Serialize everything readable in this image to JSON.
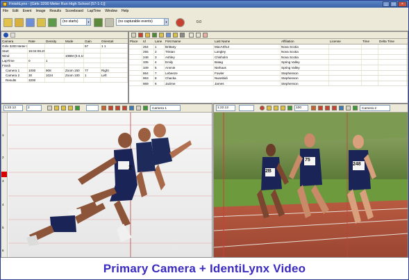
{
  "window": {
    "title": "FinishLynx - [Girls 3200 Meter Run High School (57-1-1)]",
    "buttons": [
      "_",
      "□",
      "×"
    ]
  },
  "menubar": [
    "File",
    "Edit",
    "Event",
    "Image",
    "Results",
    "Scoreboard",
    "LapTime",
    "Window",
    "Help"
  ],
  "toolbar": {
    "starts_select": "(no starts)",
    "events_select": "(no capturable events)",
    "counter": "0.0"
  },
  "event_panel": {
    "columns": [
      "Camera",
      "Rate",
      "Density",
      "Mode",
      "Gain",
      "Orientati"
    ],
    "rows": [
      {
        "cells": [
          "Girls 3200 Meter Run High School",
          "",
          "",
          "",
          "57",
          "1   1"
        ],
        "sub": false
      },
      {
        "cells": [
          "Start",
          "15:04:08.25",
          "",
          "",
          "",
          ""
        ],
        "sub": false
      },
      {
        "cells": [
          "Wind",
          "",
          "",
          "10BM (0.0,10.0)",
          "",
          ""
        ],
        "sub": false
      },
      {
        "cells": [
          "LapTime",
          "0",
          "1",
          "",
          "",
          ""
        ],
        "sub": false
      },
      {
        "cells": [
          "Finish",
          "",
          "",
          "",
          "",
          ""
        ],
        "sub": false
      },
      {
        "cells": [
          "Camera 1",
          "1000",
          "908",
          "Zoom 150",
          "77",
          "Right"
        ],
        "sub": true
      },
      {
        "cells": [
          "Camera 2",
          "30",
          "1024",
          "Zoom 100",
          "1",
          "Left"
        ],
        "sub": true
      },
      {
        "cells": [
          "Results",
          "3200",
          "",
          "",
          "",
          ""
        ],
        "sub": true
      }
    ]
  },
  "results_panel": {
    "columns": [
      "Place",
      "Id",
      "Lane",
      "First Name",
      "Last Name",
      "Affiliation",
      "License",
      "Time",
      "Delta Time"
    ],
    "rows": [
      [
        "",
        "254",
        "1",
        "Brittany",
        "MacArthur",
        "Nova Scotia",
        "",
        "",
        ""
      ],
      [
        "",
        "255",
        "2",
        "Tristan",
        "Langley",
        "Nova Scotia",
        "",
        "",
        ""
      ],
      [
        "",
        "248",
        "3",
        "Ashley",
        "Chisholm",
        "Nova Scotia",
        "",
        "",
        ""
      ],
      [
        "",
        "335",
        "4",
        "Emily",
        "Batag",
        "Spring Valley",
        "",
        "",
        ""
      ],
      [
        "",
        "349",
        "5",
        "Annnie",
        "Niehaus",
        "Spring Valley",
        "",
        "",
        ""
      ],
      [
        "",
        "864",
        "7",
        "Lebeeze",
        "Fowler",
        "Stephenson",
        "",
        "",
        ""
      ],
      [
        "",
        "863",
        "8",
        "Chacka",
        "Nwosbidi",
        "Stephenson",
        "",
        "",
        ""
      ],
      [
        "",
        "869",
        "6",
        "Jazime",
        "James",
        "Stephenson",
        "",
        "",
        ""
      ]
    ]
  },
  "camera1": {
    "time": "1:22.12",
    "frame": "2",
    "label": "Camera 1",
    "ruler": [
      "1",
      "2",
      "3",
      "4",
      "5",
      "6"
    ]
  },
  "camera2": {
    "time": "1:22.12",
    "value": "100",
    "label": "Camera 2"
  },
  "bibs": {
    "cam1_runner": "2",
    "cam2_runner_a": "2B",
    "cam2_runner_b": "75",
    "cam2_runner_c": "248"
  },
  "caption": "Primary Camera + IdentiLynx Video",
  "colors": {
    "caption": "#3a2ac0",
    "titlebar": "#3b64a8",
    "chrome": "#ece9d8"
  }
}
